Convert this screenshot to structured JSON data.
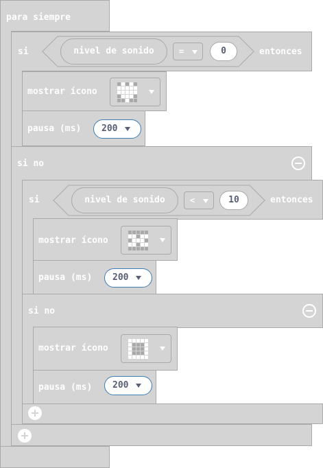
{
  "forever": {
    "label": "para siempre"
  },
  "if_outer": {
    "if_label": "si",
    "sound_label": "nivel de sonido",
    "operator": "=",
    "compare_value": "0",
    "then_label": "entonces",
    "show_icon_label": "mostrar ícono",
    "icon": "heart-icon",
    "icon_pixels": [
      0,
      1,
      0,
      1,
      0,
      1,
      1,
      1,
      1,
      1,
      1,
      1,
      1,
      1,
      1,
      0,
      1,
      1,
      1,
      0,
      0,
      0,
      1,
      0,
      0
    ],
    "pause_label": "pausa (ms)",
    "pause_value": "200",
    "else_label": "si no"
  },
  "if_inner": {
    "if_label": "si",
    "sound_label": "nivel de sonido",
    "operator": "<",
    "compare_value": "10",
    "then_label": "entonces",
    "show_icon_label": "mostrar ícono",
    "icon": "duck-icon",
    "icon_pixels": [
      0,
      0,
      0,
      0,
      0,
      1,
      1,
      0,
      1,
      1,
      0,
      1,
      1,
      1,
      0,
      1,
      1,
      0,
      1,
      1,
      0,
      0,
      0,
      0,
      0
    ],
    "pause_label": "pausa (ms)",
    "pause_value": "200",
    "else_label": "si no",
    "else_show_icon_label": "mostrar ícono",
    "else_icon": "square-icon",
    "else_icon_pixels": [
      1,
      1,
      1,
      1,
      1,
      1,
      0,
      0,
      0,
      1,
      1,
      0,
      0,
      0,
      1,
      1,
      0,
      0,
      0,
      1,
      1,
      1,
      1,
      1,
      1
    ],
    "else_pause_label": "pausa (ms)",
    "else_pause_value": "200"
  },
  "colors": {
    "block_fill": "#d4d4d4",
    "block_border": "#a9a9a9",
    "text": "#ffffff",
    "field_text": "#575e75",
    "field_focus_border": "#3c7cb4",
    "led_on": "#ffffff",
    "led_off": "#a9a9a9"
  }
}
